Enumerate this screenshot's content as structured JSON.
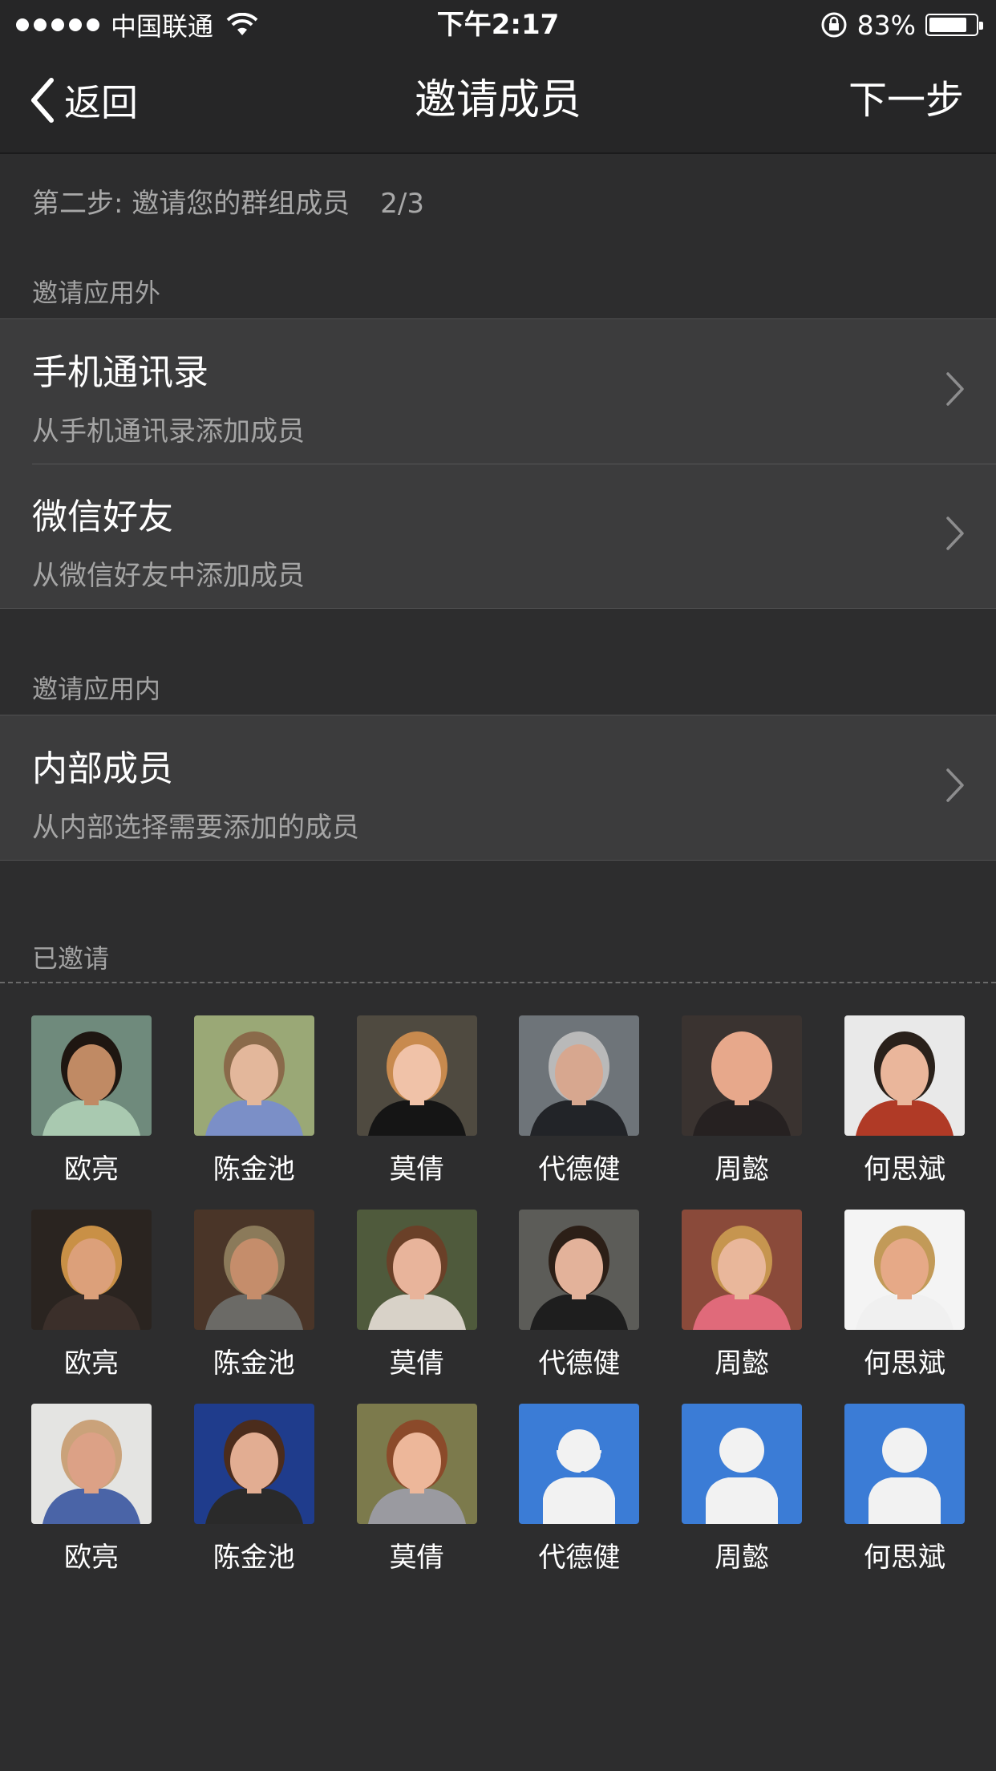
{
  "status_bar": {
    "carrier": "中国联通",
    "time": "下午2:17",
    "battery_percent": "83%",
    "battery_level": 0.83
  },
  "nav": {
    "back_label": "返回",
    "title": "邀请成员",
    "next_label": "下一步"
  },
  "step": {
    "text": "第二步: 邀请您的群组成员",
    "count": "2/3"
  },
  "external": {
    "label": "邀请应用外",
    "items": [
      {
        "title": "手机通讯录",
        "subtitle": "从手机通讯录添加成员"
      },
      {
        "title": "微信好友",
        "subtitle": "从微信好友中添加成员"
      }
    ]
  },
  "internal": {
    "label": "邀请应用内",
    "items": [
      {
        "title": "内部成员",
        "subtitle": "从内部选择需要添加的成员"
      }
    ]
  },
  "invited": {
    "label": "已邀请",
    "members": [
      {
        "name": "欧亮",
        "avatar": "photo-man-smiling",
        "bg": "#6f8a7c",
        "skin": "#c08a64",
        "hair": "#1e1611",
        "shirt": "#a9c9b0"
      },
      {
        "name": "陈金池",
        "avatar": "photo-man-glasses",
        "bg": "#9aa876",
        "skin": "#e3b79b",
        "hair": "#8a6a4a",
        "shirt": "#7b8fc7"
      },
      {
        "name": "莫倩",
        "avatar": "photo-woman-blonde",
        "bg": "#4f4a40",
        "skin": "#f0c2a8",
        "hair": "#c88a4e",
        "shirt": "#151515"
      },
      {
        "name": "代德健",
        "avatar": "photo-man-grey-beard",
        "bg": "#6e7479",
        "skin": "#d7a78f",
        "hair": "#b9b9b9",
        "shirt": "#222428"
      },
      {
        "name": "周懿",
        "avatar": "photo-man-bald",
        "bg": "#3a3330",
        "skin": "#e7a88b",
        "hair": "#e7a88b",
        "shirt": "#262121"
      },
      {
        "name": "何思斌",
        "avatar": "photo-man-red-sweater",
        "bg": "#e9e9e9",
        "skin": "#eab69b",
        "hair": "#2a211b",
        "shirt": "#b03a26"
      },
      {
        "name": "欧亮",
        "avatar": "photo-woman-curly",
        "bg": "#2a2420",
        "skin": "#dca07a",
        "hair": "#c99046",
        "shirt": "#3b2f2a"
      },
      {
        "name": "陈金池",
        "avatar": "photo-man-hat",
        "bg": "#4a3528",
        "skin": "#c58d6b",
        "hair": "#8b7a5a",
        "shirt": "#6b6a66"
      },
      {
        "name": "莫倩",
        "avatar": "photo-woman-brown-hair",
        "bg": "#4f5a3c",
        "skin": "#e8b49b",
        "hair": "#6a4028",
        "shirt": "#d8d2c8"
      },
      {
        "name": "代德健",
        "avatar": "photo-woman-dark-hair",
        "bg": "#5c5c58",
        "skin": "#e3b29a",
        "hair": "#2c1f17",
        "shirt": "#1e1e1e"
      },
      {
        "name": "周懿",
        "avatar": "photo-woman-brick",
        "bg": "#8a4a3a",
        "skin": "#e9b79b",
        "hair": "#c6954f",
        "shirt": "#e06a7a"
      },
      {
        "name": "何思斌",
        "avatar": "photo-woman-white-bg",
        "bg": "#f4f4f4",
        "skin": "#e6a987",
        "hair": "#c29a58",
        "shirt": "#f0f0f0"
      },
      {
        "name": "欧亮",
        "avatar": "photo-man-bald-glasses",
        "bg": "#e4e4e2",
        "skin": "#dca186",
        "hair": "#caa27a",
        "shirt": "#4a64a7"
      },
      {
        "name": "陈金池",
        "avatar": "photo-woman-blue-bg",
        "bg": "#1f3c8c",
        "skin": "#e2ad92",
        "hair": "#4b2c1c",
        "shirt": "#2a2a2a"
      },
      {
        "name": "莫倩",
        "avatar": "photo-woman-sunglasses",
        "bg": "#7c7a4c",
        "skin": "#edb79a",
        "hair": "#8b4a2a",
        "shirt": "#9a9aa0"
      },
      {
        "name": "代德健",
        "avatar": "default-avatar-headset-icon",
        "bg": "#3b7cd6",
        "placeholder": true,
        "headset": true
      },
      {
        "name": "周懿",
        "avatar": "default-avatar-icon",
        "bg": "#3b7cd6",
        "placeholder": true
      },
      {
        "name": "何思斌",
        "avatar": "default-avatar-icon",
        "bg": "#3b7cd6",
        "placeholder": true
      }
    ]
  }
}
